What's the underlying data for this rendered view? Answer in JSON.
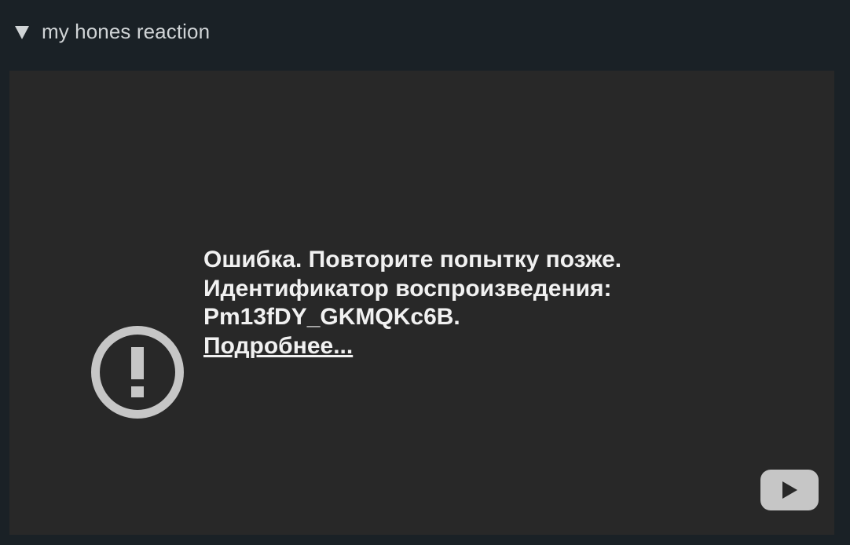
{
  "header": {
    "toggle_icon": "triangle-down-icon",
    "title": "my hones reaction"
  },
  "player": {
    "error_icon": "error-exclamation-icon",
    "error_message": "Ошибка. Повторите попытку позже.",
    "playback_id_label": "Идентификатор воспроизведения:",
    "playback_id": "Pm13fDY_GKMQKc6B.",
    "learn_more_link": "Подробнее...",
    "youtube_icon": "youtube-play-icon"
  },
  "colors": {
    "page_background": "#1a2126",
    "player_background": "#282828",
    "text": "#f1f1f1",
    "icon": "#c6c6c6"
  }
}
